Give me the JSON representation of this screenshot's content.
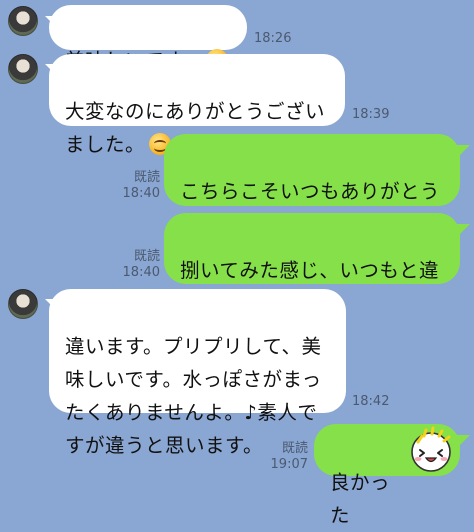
{
  "chat": {
    "messages": [
      {
        "side": "in",
        "text": "美味しいです。",
        "emoji": "smiling-face",
        "time": "18:26"
      },
      {
        "side": "in",
        "text": "大変なのにありがとうござい\nました。",
        "emoji": "smiling-face",
        "time": "18:39"
      },
      {
        "side": "out",
        "text": "こちらこそいつもありがとう\nございます",
        "emoji": "smiling-face",
        "read": "既読",
        "time": "18:40"
      },
      {
        "side": "out",
        "text": "捌いてみた感じ、いつもと違\nいはありました？",
        "read": "既読",
        "time": "18:40"
      },
      {
        "side": "in",
        "text": "違います。プリプリして、美\n味しいです。水っぽさがまっ\nたくありませんよ。♪素人で\nすが違うと思います。",
        "time": "18:42"
      },
      {
        "side": "out",
        "text": "良かった",
        "emoji": "laughing-sticker",
        "read": "既読",
        "time": "19:07"
      }
    ]
  },
  "colors": {
    "background": "#8aa6d2",
    "incoming_bubble": "#ffffff",
    "outgoing_bubble": "#86e04a",
    "meta_text": "#4b5a70"
  }
}
